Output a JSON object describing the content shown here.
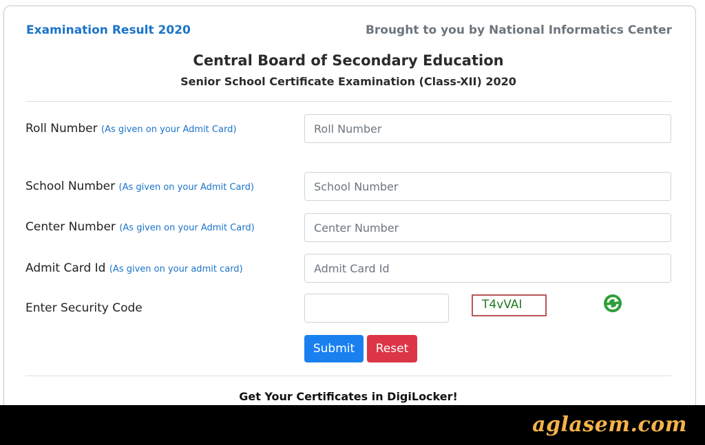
{
  "header": {
    "left_title": "Examination Result 2020",
    "right_title": "Brought to you by National Informatics Center",
    "board": "Central Board of Secondary Education",
    "exam": "Senior School Certificate Examination (Class-XII) 2020"
  },
  "form": {
    "roll": {
      "label": "Roll Number",
      "hint": "(As given on your Admit Card)",
      "placeholder": "Roll Number"
    },
    "school": {
      "label": "School Number",
      "hint": "(As given on your Admit Card)",
      "placeholder": "School Number"
    },
    "center": {
      "label": "Center Number",
      "hint": "(As given on your Admit Card)",
      "placeholder": "Center Number"
    },
    "admit": {
      "label": "Admit Card Id",
      "hint": "(As given on your admit card)",
      "placeholder": "Admit Card Id"
    },
    "security": {
      "label": "Enter Security Code",
      "captcha_text": "T4vVAI",
      "refresh_icon": "refresh-icon"
    },
    "submit_label": "Submit",
    "reset_label": "Reset"
  },
  "digilocker": "Get Your Certificates in DigiLocker!",
  "watermark": "aglasem.com",
  "colors": {
    "link": "#1a73c9",
    "submit": "#1a80f0",
    "reset": "#dc3545",
    "captcha_text": "#1f7a1f",
    "watermark": "#f5b24a"
  }
}
